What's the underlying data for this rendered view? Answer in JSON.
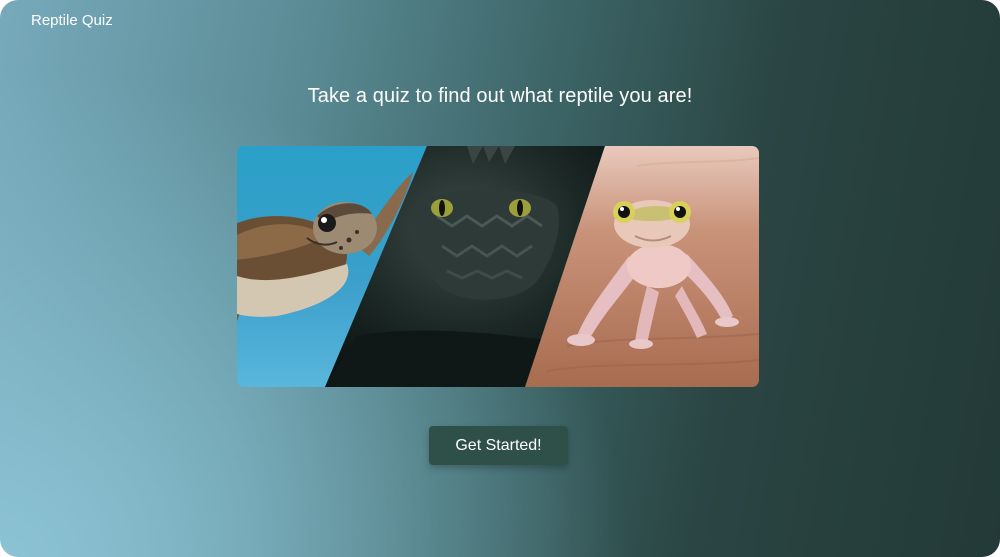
{
  "app": {
    "title": "Reptile Quiz"
  },
  "main": {
    "headline": "Take a quiz to find out what reptile you are!",
    "hero_image": {
      "panels": [
        "sea-turtle",
        "crocodile",
        "gecko"
      ]
    },
    "cta_label": "Get Started!"
  },
  "colors": {
    "background_left": "#8cc3d4",
    "background_right": "#223937",
    "button": "#2f5049",
    "text": "#ffffff"
  }
}
